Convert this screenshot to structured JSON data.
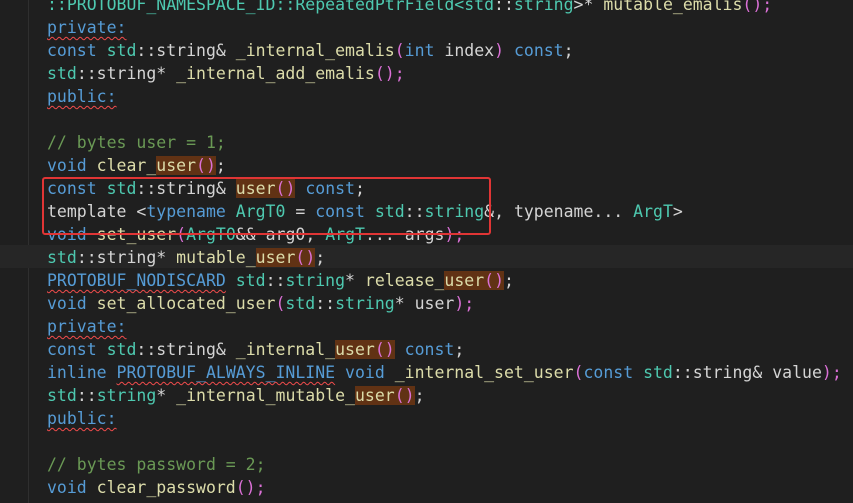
{
  "editor": {
    "lines": [
      {
        "tokens": [
          {
            "t": "::PROTOBUF_NAMESPACE_ID::RepeatedPtrField<",
            "c": "ty"
          },
          {
            "t": "std",
            "c": "ty"
          },
          {
            "t": "::",
            "c": "pl"
          },
          {
            "t": "string",
            "c": "ty"
          },
          {
            "t": ">* ",
            "c": "pl"
          },
          {
            "t": "mutable_emalis",
            "c": "fn"
          },
          {
            "t": "();",
            "c": "br"
          }
        ]
      },
      {
        "tokens": [
          {
            "t": "private:",
            "c": "kw sq"
          }
        ]
      },
      {
        "tokens": [
          {
            "t": "const ",
            "c": "kw"
          },
          {
            "t": "std",
            "c": "ty"
          },
          {
            "t": "::string& ",
            "c": "pl"
          },
          {
            "t": "_internal_emalis",
            "c": "fn"
          },
          {
            "t": "(",
            "c": "br"
          },
          {
            "t": "int ",
            "c": "kw"
          },
          {
            "t": "index",
            "c": "pl"
          },
          {
            "t": ")",
            "c": "br"
          },
          {
            "t": " const",
            "c": "kw"
          },
          {
            "t": ";",
            "c": "pl"
          }
        ]
      },
      {
        "tokens": [
          {
            "t": "std",
            "c": "ty"
          },
          {
            "t": "::string* ",
            "c": "pl"
          },
          {
            "t": "_internal_add_emalis",
            "c": "fn"
          },
          {
            "t": "();",
            "c": "br"
          }
        ]
      },
      {
        "tokens": [
          {
            "t": "public:",
            "c": "kw sq"
          }
        ]
      },
      {
        "tokens": []
      },
      {
        "tokens": [
          {
            "t": "// bytes user = 1;",
            "c": "cm"
          }
        ]
      },
      {
        "tokens": [
          {
            "t": "void ",
            "c": "kw"
          },
          {
            "t": "clear_",
            "c": "fn"
          },
          {
            "t": "user",
            "c": "fn hl"
          },
          {
            "t": "()",
            "c": "br hl"
          },
          {
            "t": ";",
            "c": "pl"
          }
        ]
      },
      {
        "tokens": [
          {
            "t": "const ",
            "c": "kw"
          },
          {
            "t": "std",
            "c": "ty"
          },
          {
            "t": "::string& ",
            "c": "pl"
          },
          {
            "t": "user",
            "c": "fn hl"
          },
          {
            "t": "()",
            "c": "br hl"
          },
          {
            "t": " const",
            "c": "kw"
          },
          {
            "t": ";",
            "c": "pl"
          }
        ]
      },
      {
        "tokens": [
          {
            "t": "template ",
            "c": "pl"
          },
          {
            "t": "<",
            "c": "pl"
          },
          {
            "t": "typename ",
            "c": "kw"
          },
          {
            "t": "ArgT0",
            "c": "ty"
          },
          {
            "t": " = ",
            "c": "pl"
          },
          {
            "t": "const ",
            "c": "kw"
          },
          {
            "t": "std",
            "c": "ty"
          },
          {
            "t": "::",
            "c": "pl"
          },
          {
            "t": "string",
            "c": "ty"
          },
          {
            "t": "&, typename... ",
            "c": "pl"
          },
          {
            "t": "ArgT",
            "c": "ty"
          },
          {
            "t": ">",
            "c": "pl"
          }
        ]
      },
      {
        "tokens": [
          {
            "t": "void ",
            "c": "kw"
          },
          {
            "t": "set_user",
            "c": "fn"
          },
          {
            "t": "(",
            "c": "br"
          },
          {
            "t": "ArgT0",
            "c": "ty"
          },
          {
            "t": "&& ",
            "c": "pl"
          },
          {
            "t": "arg0",
            "c": "pl"
          },
          {
            "t": ", ",
            "c": "pl"
          },
          {
            "t": "ArgT",
            "c": "ty"
          },
          {
            "t": "... ",
            "c": "pl"
          },
          {
            "t": "args",
            "c": "pl"
          },
          {
            "t": ");",
            "c": "br"
          }
        ]
      },
      {
        "tokens": [
          {
            "t": "std",
            "c": "ty"
          },
          {
            "t": "::string* ",
            "c": "pl"
          },
          {
            "t": "mutable_",
            "c": "fn"
          },
          {
            "t": "user",
            "c": "fn hl"
          },
          {
            "t": "()",
            "c": "br hl"
          },
          {
            "t": ";",
            "c": "pl"
          }
        ]
      },
      {
        "tokens": [
          {
            "t": "PROTOBUF_NODISCARD",
            "c": "kw sq"
          },
          {
            "t": " ",
            "c": "pl"
          },
          {
            "t": "std",
            "c": "ty"
          },
          {
            "t": "::",
            "c": "pl"
          },
          {
            "t": "string",
            "c": "ty"
          },
          {
            "t": "* ",
            "c": "pl"
          },
          {
            "t": "release_",
            "c": "fn"
          },
          {
            "t": "user",
            "c": "fn hl"
          },
          {
            "t": "()",
            "c": "br hl"
          },
          {
            "t": ";",
            "c": "pl"
          }
        ]
      },
      {
        "tokens": [
          {
            "t": "void ",
            "c": "kw"
          },
          {
            "t": "set_allocated_user",
            "c": "fn"
          },
          {
            "t": "(",
            "c": "br"
          },
          {
            "t": "std",
            "c": "ty"
          },
          {
            "t": "::",
            "c": "pl"
          },
          {
            "t": "string",
            "c": "ty"
          },
          {
            "t": "* ",
            "c": "pl"
          },
          {
            "t": "user",
            "c": "pl"
          },
          {
            "t": ");",
            "c": "br"
          }
        ]
      },
      {
        "tokens": [
          {
            "t": "private:",
            "c": "kw sq"
          }
        ]
      },
      {
        "tokens": [
          {
            "t": "const ",
            "c": "kw"
          },
          {
            "t": "std",
            "c": "ty"
          },
          {
            "t": "::string& ",
            "c": "pl"
          },
          {
            "t": "_internal_",
            "c": "fn"
          },
          {
            "t": "user",
            "c": "fn hl"
          },
          {
            "t": "()",
            "c": "br hl"
          },
          {
            "t": " const",
            "c": "kw"
          },
          {
            "t": ";",
            "c": "pl"
          }
        ]
      },
      {
        "tokens": [
          {
            "t": "inline ",
            "c": "kw"
          },
          {
            "t": "PROTOBUF_ALWAYS_INLINE",
            "c": "kw sq"
          },
          {
            "t": " void ",
            "c": "kw"
          },
          {
            "t": "_internal_set_user",
            "c": "fn"
          },
          {
            "t": "(",
            "c": "br"
          },
          {
            "t": "const ",
            "c": "kw"
          },
          {
            "t": "std",
            "c": "ty"
          },
          {
            "t": "::string& ",
            "c": "pl"
          },
          {
            "t": "value",
            "c": "pl"
          },
          {
            "t": ");",
            "c": "br"
          }
        ]
      },
      {
        "tokens": [
          {
            "t": "std",
            "c": "ty"
          },
          {
            "t": "::",
            "c": "pl"
          },
          {
            "t": "string",
            "c": "ty"
          },
          {
            "t": "* ",
            "c": "pl"
          },
          {
            "t": "_internal_mutable_",
            "c": "fn"
          },
          {
            "t": "user",
            "c": "fn hl"
          },
          {
            "t": "()",
            "c": "br hl"
          },
          {
            "t": ";",
            "c": "pl"
          }
        ]
      },
      {
        "tokens": [
          {
            "t": "public:",
            "c": "kw sq"
          }
        ]
      },
      {
        "tokens": []
      },
      {
        "tokens": [
          {
            "t": "// bytes password = 2;",
            "c": "cm"
          }
        ]
      },
      {
        "tokens": [
          {
            "t": "void ",
            "c": "kw"
          },
          {
            "t": "clear_password",
            "c": "fn"
          },
          {
            "t": "();",
            "c": "br"
          }
        ]
      }
    ]
  }
}
